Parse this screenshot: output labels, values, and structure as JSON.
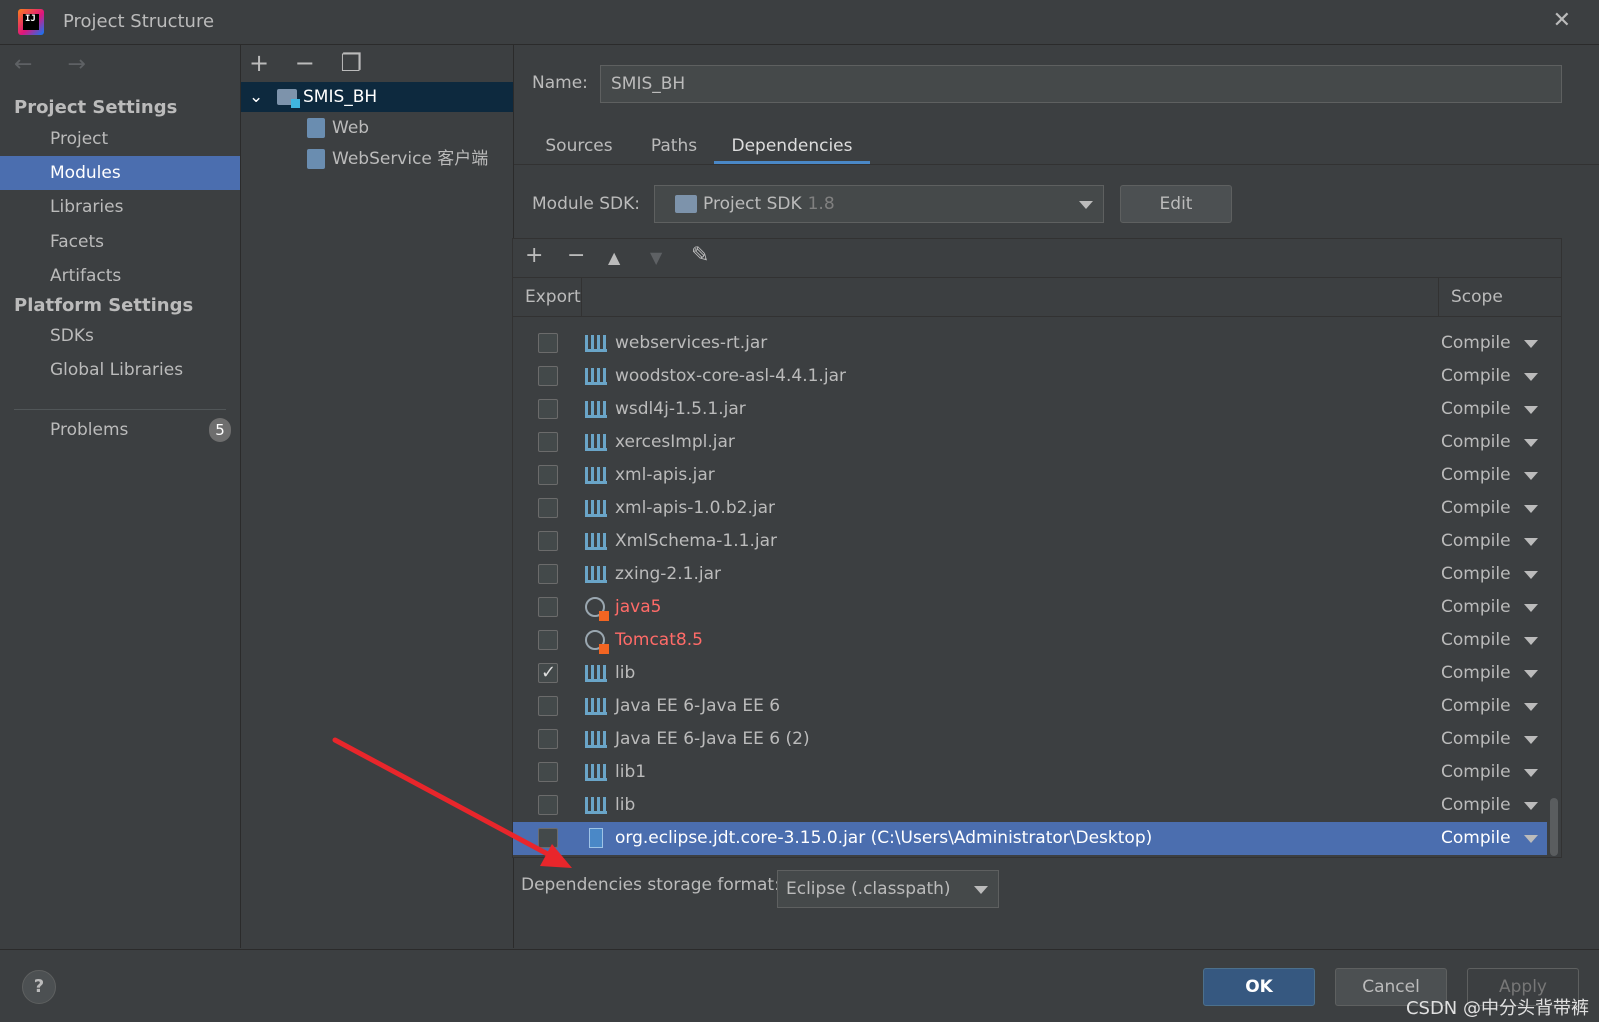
{
  "window": {
    "title": "Project Structure",
    "close_glyph": "✕",
    "logo_text": "IJ"
  },
  "nav": {
    "back_forward": "← →",
    "project_settings_heading": "Project Settings",
    "project_settings": [
      "Project",
      "Modules",
      "Libraries",
      "Facets",
      "Artifacts"
    ],
    "platform_settings_heading": "Platform Settings",
    "platform_settings": [
      "SDKs",
      "Global Libraries"
    ],
    "problems": "Problems",
    "problems_count": "5",
    "selected": "Modules"
  },
  "tree": {
    "toolbar": [
      "+",
      "−",
      "❐"
    ],
    "root": "SMIS_BH",
    "children": [
      "Web",
      "WebService 客户端"
    ]
  },
  "module": {
    "name_label": "Name:",
    "name_value": "SMIS_BH",
    "tabs": [
      "Sources",
      "Paths",
      "Dependencies"
    ],
    "active_tab": "Dependencies",
    "sdk_label": "Module SDK:",
    "sdk_value": "Project SDK",
    "sdk_version": "1.8",
    "edit_label": "Edit"
  },
  "deps": {
    "toolbar": [
      "+",
      "−",
      "▲",
      "▼",
      "✎"
    ],
    "col_export": "Export",
    "col_scope": "Scope",
    "rows": [
      {
        "name": "webservices-rt.jar",
        "scope": "Compile",
        "checked": false,
        "icon": "library-icon",
        "error": false
      },
      {
        "name": "woodstox-core-asl-4.4.1.jar",
        "scope": "Compile",
        "checked": false,
        "icon": "library-icon",
        "error": false
      },
      {
        "name": "wsdl4j-1.5.1.jar",
        "scope": "Compile",
        "checked": false,
        "icon": "library-icon",
        "error": false
      },
      {
        "name": "xercesImpl.jar",
        "scope": "Compile",
        "checked": false,
        "icon": "library-icon",
        "error": false
      },
      {
        "name": "xml-apis.jar",
        "scope": "Compile",
        "checked": false,
        "icon": "library-icon",
        "error": false
      },
      {
        "name": "xml-apis-1.0.b2.jar",
        "scope": "Compile",
        "checked": false,
        "icon": "library-icon",
        "error": false
      },
      {
        "name": "XmlSchema-1.1.jar",
        "scope": "Compile",
        "checked": false,
        "icon": "library-icon",
        "error": false
      },
      {
        "name": "zxing-2.1.jar",
        "scope": "Compile",
        "checked": false,
        "icon": "library-icon",
        "error": false
      },
      {
        "name": "java5",
        "scope": "Compile",
        "checked": false,
        "icon": "globe-library-icon",
        "error": true
      },
      {
        "name": "Tomcat8.5",
        "scope": "Compile",
        "checked": false,
        "icon": "globe-library-icon",
        "error": true
      },
      {
        "name": "lib",
        "scope": "Compile",
        "checked": true,
        "icon": "library-icon",
        "error": false
      },
      {
        "name": "Java EE 6-Java EE 6",
        "scope": "Compile",
        "checked": false,
        "icon": "library-icon",
        "error": false
      },
      {
        "name": "Java EE 6-Java EE 6 (2)",
        "scope": "Compile",
        "checked": false,
        "icon": "library-icon",
        "error": false
      },
      {
        "name": "lib1",
        "scope": "Compile",
        "checked": false,
        "icon": "library-icon",
        "error": false
      },
      {
        "name": "lib",
        "scope": "Compile",
        "checked": false,
        "icon": "library-icon",
        "error": false
      },
      {
        "name": "org.eclipse.jdt.core-3.15.0.jar (C:\\Users\\Administrator\\Desktop)",
        "scope": "Compile",
        "checked": false,
        "icon": "jar-icon",
        "error": false,
        "selected": true
      }
    ],
    "storage_label": "Dependencies storage format:",
    "storage_value": "Eclipse (.classpath)"
  },
  "footer": {
    "help": "?",
    "ok": "OK",
    "cancel": "Cancel",
    "apply": "Apply"
  },
  "watermark": "CSDN @中分头背带裤",
  "colors": {
    "selection": "#4b6eaf",
    "tree_selection": "#0d293e",
    "error_text": "#ff6b68",
    "annotation_arrow": "#e8262b"
  }
}
